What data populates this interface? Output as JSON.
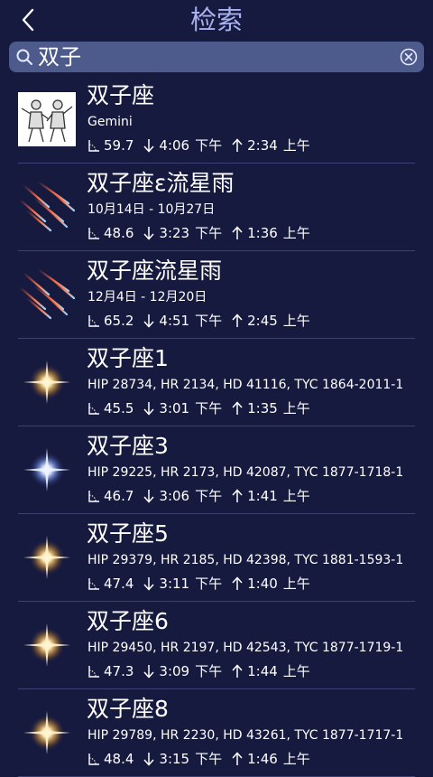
{
  "header": {
    "title": "检索"
  },
  "search": {
    "query": "双子"
  },
  "colors": {
    "background": "#171a3f",
    "title": "#a9b2f0",
    "search_bar": "#4d5a8c",
    "divider": "#3b4170"
  },
  "results": [
    {
      "name": "双子座",
      "subtitle": "Gemini",
      "altitude": "59.7",
      "set_time": "4:06",
      "set_period": "下午",
      "rise_time": "2:34",
      "rise_period": "上午",
      "thumb": "constellation-gemini"
    },
    {
      "name": "双子座ε流星雨",
      "subtitle": "10月14日 - 10月27日",
      "altitude": "48.6",
      "set_time": "3:23",
      "set_period": "下午",
      "rise_time": "1:36",
      "rise_period": "上午",
      "thumb": "meteor-shower"
    },
    {
      "name": "双子座流星雨",
      "subtitle": "12月4日 - 12月20日",
      "altitude": "65.2",
      "set_time": "4:51",
      "set_period": "下午",
      "rise_time": "2:45",
      "rise_period": "上午",
      "thumb": "meteor-shower"
    },
    {
      "name": "双子座1",
      "subtitle": "HIP 28734, HR 2134, HD 41116, TYC 1864-2011-1",
      "altitude": "45.5",
      "set_time": "3:01",
      "set_period": "下午",
      "rise_time": "1:35",
      "rise_period": "上午",
      "thumb": "star-gold"
    },
    {
      "name": "双子座3",
      "subtitle": "HIP 29225, HR 2173, HD 42087, TYC 1877-1718-1",
      "altitude": "46.7",
      "set_time": "3:06",
      "set_period": "下午",
      "rise_time": "1:41",
      "rise_period": "上午",
      "thumb": "star-blue"
    },
    {
      "name": "双子座5",
      "subtitle": "HIP 29379, HR 2185, HD 42398, TYC 1881-1593-1",
      "altitude": "47.4",
      "set_time": "3:11",
      "set_period": "下午",
      "rise_time": "1:40",
      "rise_period": "上午",
      "thumb": "star-gold"
    },
    {
      "name": "双子座6",
      "subtitle": "HIP 29450, HR 2197, HD 42543, TYC 1877-1719-1",
      "altitude": "47.3",
      "set_time": "3:09",
      "set_period": "下午",
      "rise_time": "1:44",
      "rise_period": "上午",
      "thumb": "star-gold"
    },
    {
      "name": "双子座8",
      "subtitle": "HIP 29789, HR 2230, HD 43261, TYC 1877-1717-1",
      "altitude": "48.4",
      "set_time": "3:15",
      "set_period": "下午",
      "rise_time": "1:46",
      "rise_period": "上午",
      "thumb": "star-gold"
    }
  ]
}
